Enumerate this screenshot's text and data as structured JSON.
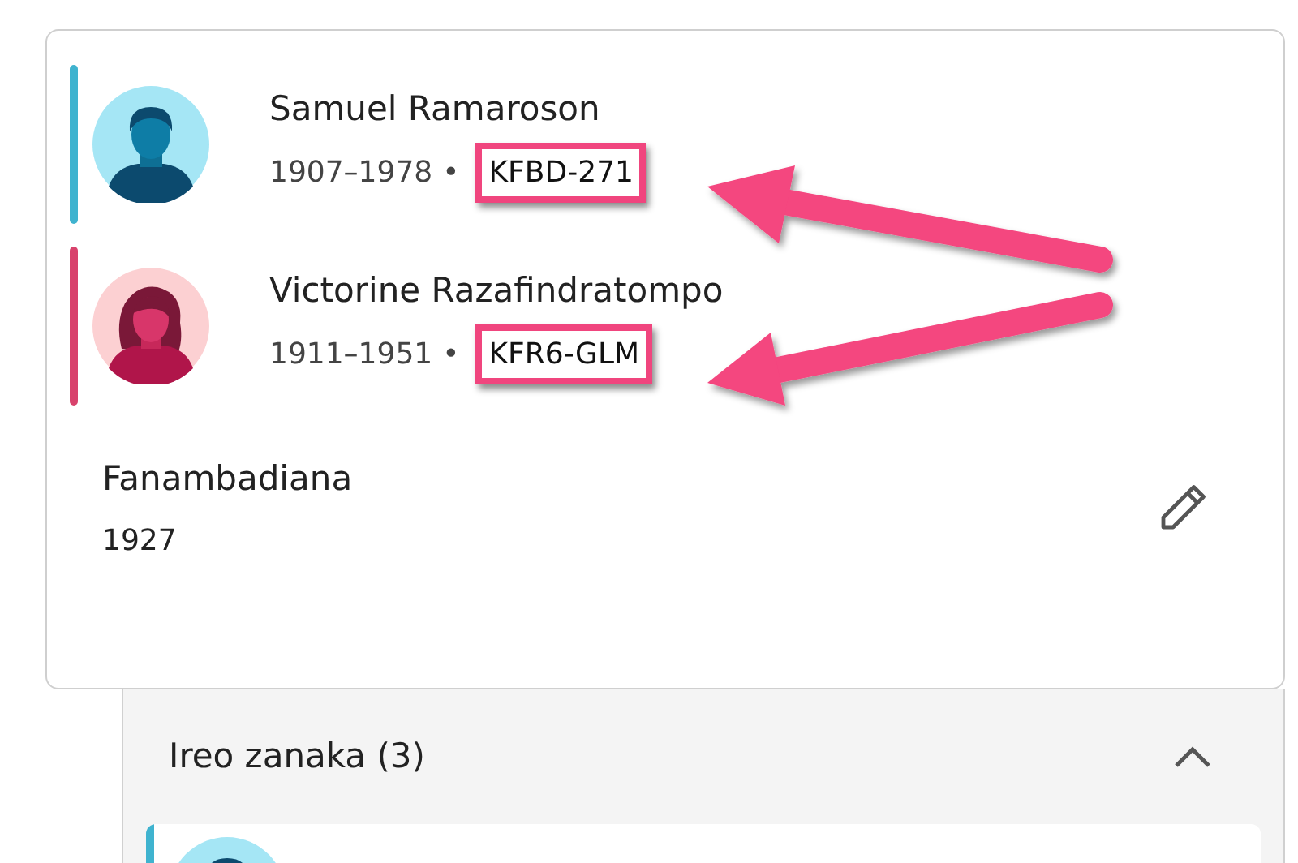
{
  "couple": [
    {
      "kind": "male",
      "name": "Samuel Ramaroson",
      "years": "1907–1978",
      "separator": "•",
      "id": "KFBD-271",
      "highlighted": true,
      "color": "#3fb3cf"
    },
    {
      "kind": "female",
      "name": "Victorine Razafindratompo",
      "years": "1911–1951",
      "separator": "•",
      "id": "KFR6-GLM",
      "highlighted": true,
      "color": "#d8426c"
    }
  ],
  "event": {
    "title": "Fanambadiana",
    "year": "1927"
  },
  "children_section": {
    "title": "Ireo zanaka (3)",
    "expanded": true,
    "children": [
      {
        "kind": "male",
        "color": "#3fb3cf"
      }
    ]
  }
}
